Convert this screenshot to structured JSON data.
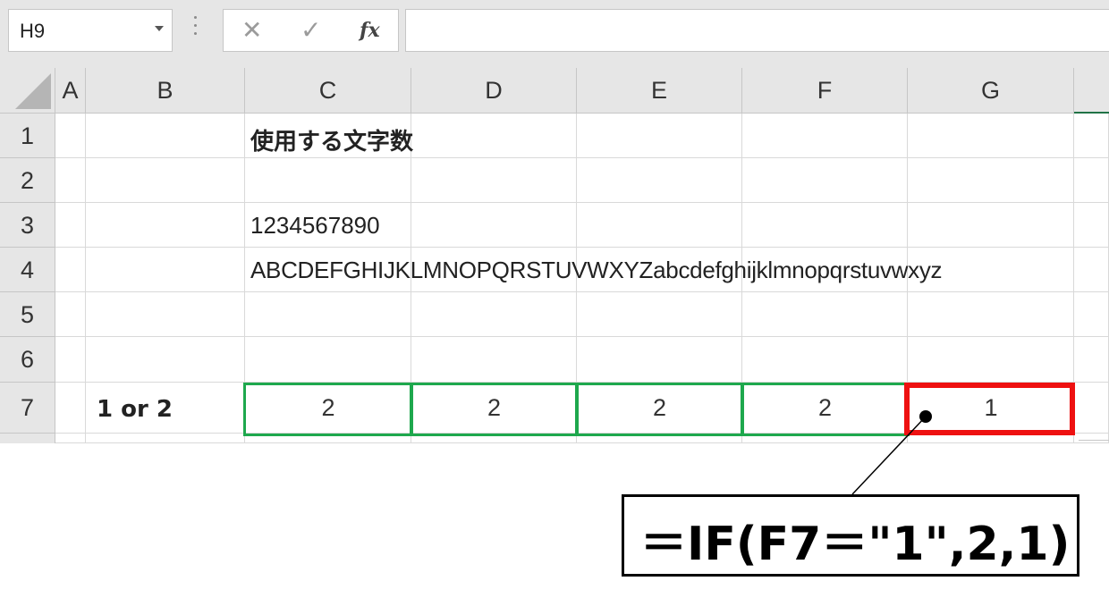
{
  "formula_bar": {
    "name_box": "H9",
    "cancel_glyph": "✕",
    "enter_glyph": "✓",
    "fx_label": "fx",
    "formula": ""
  },
  "columns": [
    "A",
    "B",
    "C",
    "D",
    "E",
    "F",
    "G"
  ],
  "rows": [
    "1",
    "2",
    "3",
    "4",
    "5",
    "6",
    "7"
  ],
  "cells": {
    "C1": "使用する文字数",
    "C3": "1234567890",
    "C4": "ABCDEFGHIJKLMNOPQRSTUVWXYZabcdefghijklmnopqrstuvwxyz",
    "B7": "1 or 2",
    "C7": "2",
    "D7": "2",
    "E7": "2",
    "F7": "2",
    "G7": "1"
  },
  "annotation": {
    "formula_text": "＝IF(F7＝\"1\",2,1)",
    "highlight_colors": {
      "green": "#1ea84d",
      "red": "#ee1111"
    }
  }
}
